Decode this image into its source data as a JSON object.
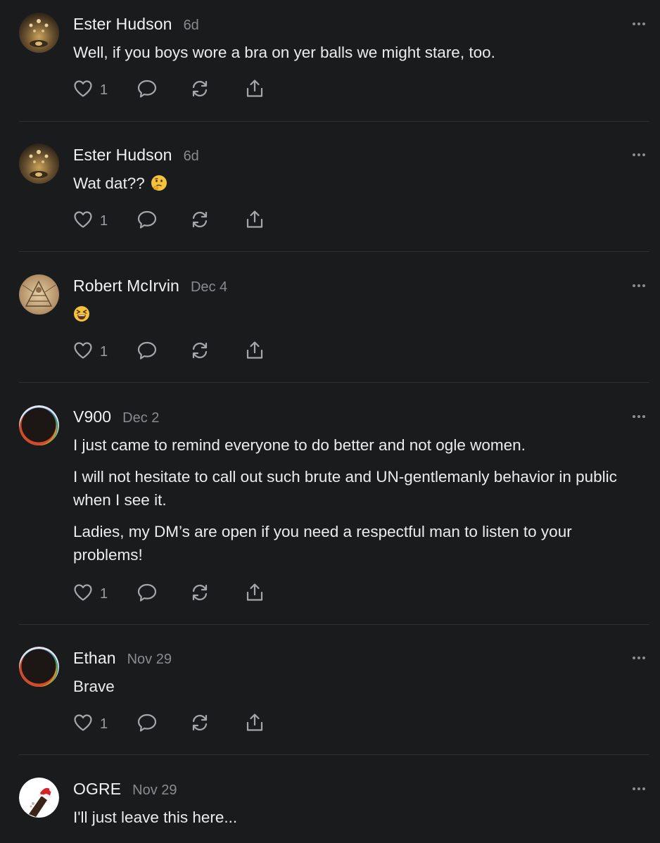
{
  "comments": [
    {
      "author": "Ester Hudson",
      "time": "6d",
      "avatar": "dark-ornate-avatar",
      "paragraphs": [
        "Well, if you boys wore a bra on yer balls we might stare, too."
      ],
      "likes": "1",
      "icons": {
        "like": "heart-icon",
        "reply": "comment-icon",
        "restack": "restack-icon",
        "share": "share-icon",
        "more": "more-icon"
      }
    },
    {
      "author": "Ester Hudson",
      "time": "6d",
      "avatar": "dark-ornate-avatar",
      "paragraphs": [
        "Wat dat??"
      ],
      "emoji": "thinking-face-emoji",
      "likes": "1"
    },
    {
      "author": "Robert McIrvin",
      "time": "Dec 4",
      "avatar": "sepia-engraving-avatar",
      "paragraphs": [
        ""
      ],
      "emoji": "laughing-face-emoji",
      "likes": "1"
    },
    {
      "author": "V900",
      "time": "Dec 2",
      "avatar": "eclipse-ring-avatar",
      "paragraphs": [
        "I just came to remind everyone to do better and not ogle women.",
        "I will not hesitate to call out such brute and UN-gentlemanly behavior in public when I see it.",
        "Ladies, my DM’s are open if you need a respectful man to listen to your problems!"
      ],
      "likes": "1"
    },
    {
      "author": "Ethan",
      "time": "Nov 29",
      "avatar": "eclipse-ring-avatar",
      "paragraphs": [
        "Brave"
      ],
      "likes": "1"
    },
    {
      "author": "OGRE",
      "time": "Nov 29",
      "avatar": "santa-hat-avatar",
      "paragraphs": [
        "I'll just leave this here..."
      ]
    }
  ],
  "colors": {
    "background": "#1a1b1d",
    "text": "#ececec",
    "muted": "#8a8b8e",
    "divider": "#2e2f32",
    "icon": "#a6a7aa"
  }
}
